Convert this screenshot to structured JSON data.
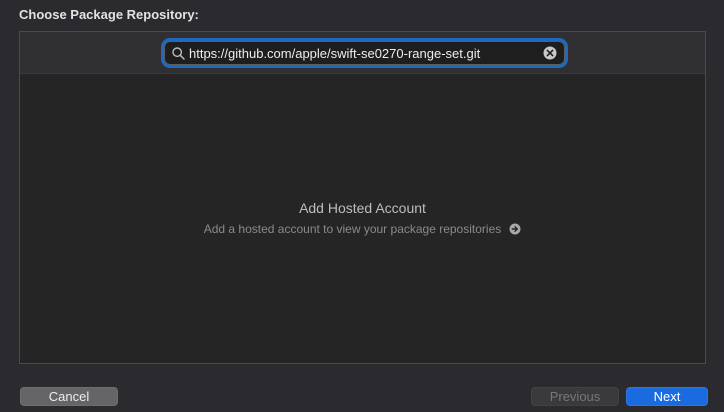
{
  "dialog": {
    "heading": "Choose Package Repository:"
  },
  "search": {
    "value": "https://github.com/apple/swift-se0270-range-set.git",
    "icon": "search-icon",
    "clear_icon": "clear-icon"
  },
  "empty_state": {
    "title": "Add Hosted Account",
    "subtitle": "Add a hosted account to view your package repositories",
    "arrow_icon": "arrow-right-circle-icon"
  },
  "buttons": {
    "cancel": "Cancel",
    "previous": "Previous",
    "next": "Next"
  },
  "colors": {
    "accent": "#1a6ae0",
    "focus_ring": "#1d6ac0",
    "background": "#2b2a2e",
    "panel": "#252526"
  }
}
